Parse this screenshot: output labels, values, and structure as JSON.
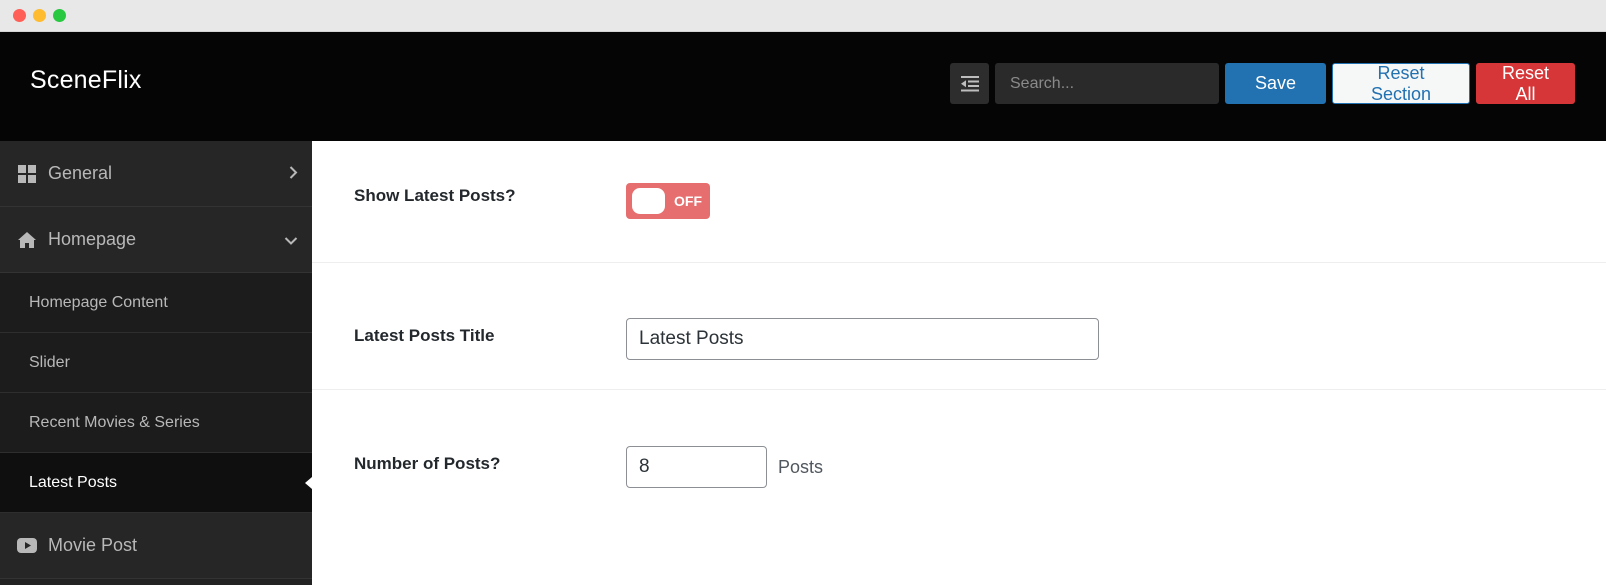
{
  "app": {
    "brand": "SceneFlix"
  },
  "toolbar": {
    "search_placeholder": "Search...",
    "save_label": "Save",
    "reset_section_label": "Reset Section",
    "reset_all_label": "Reset All"
  },
  "sidebar": {
    "general": {
      "label": "General",
      "icon": "grid-icon"
    },
    "homepage": {
      "label": "Homepage",
      "icon": "home-icon"
    },
    "sub_items": [
      {
        "label": "Homepage Content"
      },
      {
        "label": "Slider"
      },
      {
        "label": "Recent Movies & Series"
      },
      {
        "label": "Latest Posts",
        "active": true
      }
    ],
    "movie_post": {
      "label": "Movie Post",
      "icon": "youtube-icon"
    }
  },
  "fields": {
    "show_latest": {
      "label": "Show Latest Posts?",
      "toggle_text": "OFF",
      "toggle_color": "#e66e6e"
    },
    "latest_title": {
      "label": "Latest Posts Title",
      "value": "Latest Posts"
    },
    "num_posts": {
      "label": "Number of Posts?",
      "value": "8",
      "unit": "Posts"
    }
  },
  "colors": {
    "primary": "#2271b1",
    "danger": "#d63638",
    "header_bg": "#050505",
    "sidebar_bg": "#222222"
  }
}
